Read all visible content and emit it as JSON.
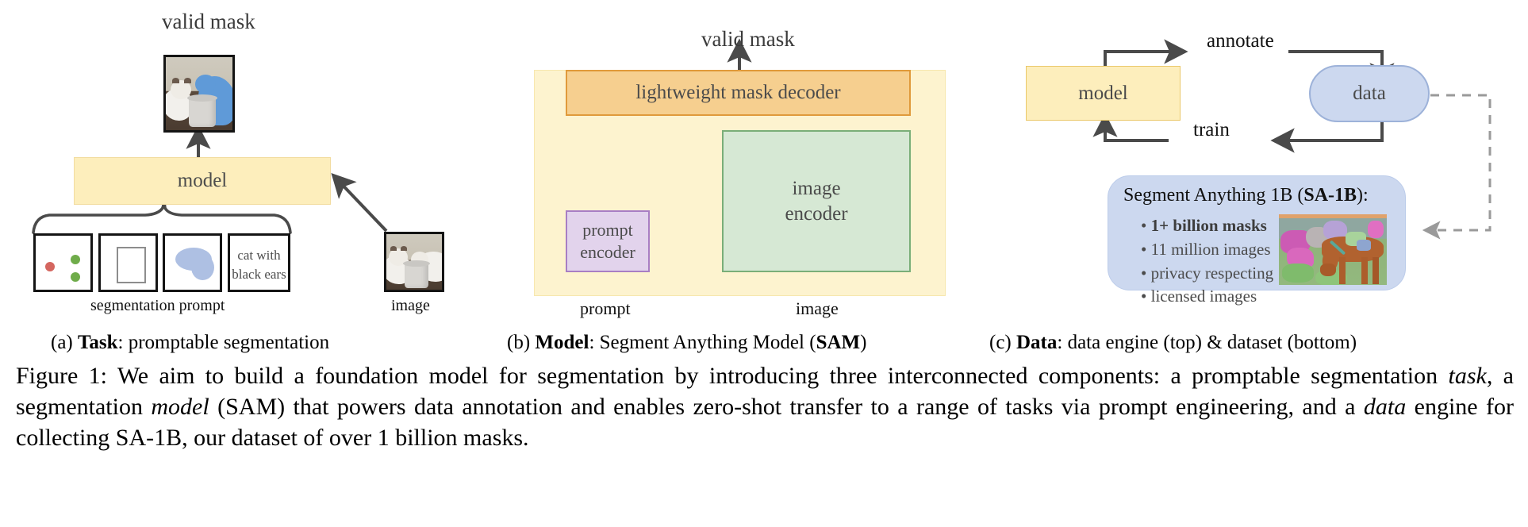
{
  "figure": {
    "caption_label": "Figure 1:",
    "caption_text": " We aim to build a foundation model for segmentation by introducing three interconnected components: a promptable segmentation ",
    "caption_italic_1": "task",
    "caption_text_2": ", a segmentation ",
    "caption_italic_2": "model",
    "caption_text_3": " (SAM) that powers data annotation and enables zero-shot transfer to a range of tasks via prompt engineering, and a ",
    "caption_italic_3": "data",
    "caption_text_4": " engine for collecting SA-1B, our dataset of over 1 billion masks.",
    "caption_full": "Figure 1: We aim to build a foundation model for segmentation by introducing three interconnected components: a promptable segmentation task, a segmentation model (SAM) that powers data annotation and enables zero-shot transfer to a range of tasks via prompt engineering, and a data engine for collecting SA-1B, our dataset of over 1 billion masks."
  },
  "panel_a": {
    "subcaption_prefix": "(a) ",
    "subcaption_bold": "Task",
    "subcaption_rest": ": promptable segmentation",
    "output_label": "valid mask",
    "model_label": "model",
    "prompt_group_label": "segmentation prompt",
    "image_label": "image",
    "prompt_cards": [
      {
        "kind": "points",
        "text": ""
      },
      {
        "kind": "box",
        "text": ""
      },
      {
        "kind": "mask",
        "text": ""
      },
      {
        "kind": "text",
        "text": "cat with black ears",
        "line1": "cat with",
        "line2": "black ears"
      }
    ]
  },
  "panel_b": {
    "subcaption_prefix": "(b) ",
    "subcaption_bold": "Model",
    "subcaption_rest": ": Segment Anything Model (",
    "subcaption_bold2": "SAM",
    "subcaption_rest2": ")",
    "output_label": "valid mask",
    "decoder_label": "lightweight mask decoder",
    "prompt_encoder_label": "prompt\nencoder",
    "prompt_encoder_line1": "prompt",
    "prompt_encoder_line2": "encoder",
    "image_encoder_line1": "image",
    "image_encoder_line2": "encoder",
    "input_prompt_label": "prompt",
    "input_image_label": "image"
  },
  "panel_c": {
    "subcaption_prefix": "(c) ",
    "subcaption_bold": "Data",
    "subcaption_rest": ": data engine (top) & dataset (bottom)",
    "model_label": "model",
    "data_label": "data",
    "annotate_label": "annotate",
    "train_label": "train",
    "dataset_title_prefix": "Segment Anything 1B (",
    "dataset_title_bold": "SA-1B",
    "dataset_title_suffix": "):",
    "dataset_bullets": [
      {
        "text": "1+ billion masks",
        "bold": true
      },
      {
        "text": "11 million images",
        "bold": false
      },
      {
        "text": "privacy respecting",
        "bold": false
      },
      {
        "text": "licensed images",
        "bold": false
      }
    ]
  },
  "colors": {
    "yellow_fill": "#fdeebc",
    "yellow_pale": "#fdf3cf",
    "orange_fill": "#f6cf8f",
    "orange_stroke": "#e09a3b",
    "purple_fill": "#e2d3ec",
    "purple_stroke": "#a87ec4",
    "green_fill": "#d6e8d4",
    "green_stroke": "#7aae78",
    "blue_fill": "#ccd8ef",
    "blue_stroke": "#9db2d9",
    "mask_blue": "#aec0e3",
    "point_positive": "#6fac4a",
    "point_negative": "#d4665f",
    "arrow_gray": "#4a4a4a",
    "dashed_gray": "#9a9a9a"
  }
}
